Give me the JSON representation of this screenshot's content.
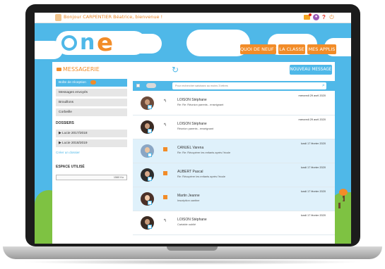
{
  "header": {
    "greeting": "Bonjour CARPENTIER Béatrice, bienvenue !"
  },
  "nav": {
    "items": [
      "QUOI DE NEUF ?",
      "LA CLASSE",
      "MES APPLIS"
    ]
  },
  "sidebar": {
    "title": "MESSAGERIE",
    "folders": [
      {
        "label": "Boîte de réception"
      },
      {
        "label": "Messages envoyés"
      },
      {
        "label": "Brouillons"
      },
      {
        "label": "Corbeille"
      }
    ],
    "dossiers_heading": "DOSSIERS",
    "dossiers": [
      {
        "label": "▶ Lucie 2017/2018"
      },
      {
        "label": "▶ Lucie 2018/2019"
      }
    ],
    "create_folder": "Créer un dossier",
    "storage_heading": "ESPACE UTILISÉ",
    "storage_value": "1560 Ko"
  },
  "main": {
    "new_message": "NOUVEAU MESSAGE",
    "search_placeholder": "Pour rechercher saisissez au moins 3 lettres",
    "messages": [
      {
        "date": "mercredi 29 avril 2020",
        "name": "LOISON Stéphane",
        "subject": "Re: Re: Réunion parents - enseignant",
        "highlighted": false,
        "action": "reply"
      },
      {
        "date": "mercredi 29 avril 2020",
        "name": "LOISON Stéphane",
        "subject": "Réunion parents - enseignant",
        "highlighted": false,
        "action": "reply"
      },
      {
        "date": "lundi 17 février 2020",
        "name": "CANUEL Varena",
        "subject": "Re: Re: Récupérer les enfants après l'école",
        "highlighted": true,
        "action": "unread"
      },
      {
        "date": "lundi 17 février 2020",
        "name": "AUBERT Pascal",
        "subject": "Re: Récupérer les enfants après l'école",
        "highlighted": true,
        "action": "unread"
      },
      {
        "date": "lundi 17 février 2020",
        "name": "Martin Jeanne",
        "subject": "Inscription cantine",
        "highlighted": true,
        "action": "unread"
      },
      {
        "date": "lundi 17 février 2020",
        "name": "LOISON Stéphane",
        "subject": "Cartable oublié",
        "highlighted": false,
        "action": "reply"
      }
    ]
  },
  "colors": {
    "accent": "#f28c28",
    "primary": "#4fb8e8",
    "highlight_row": "#dff1fb"
  }
}
